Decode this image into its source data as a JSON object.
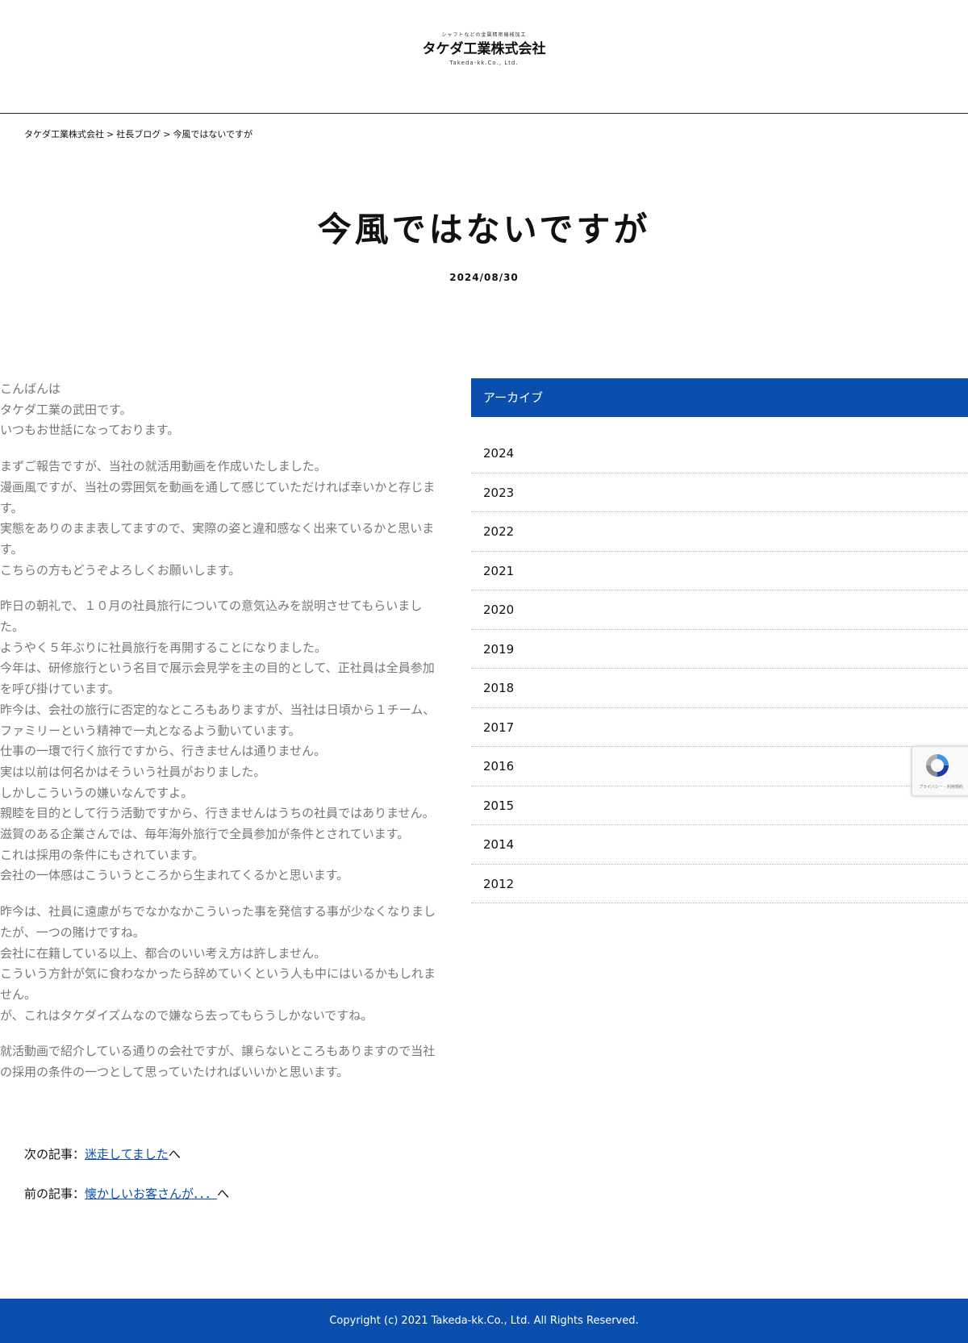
{
  "header": {
    "logo_tagline": "シャフトなどの金属精密機械加工",
    "logo_name": "タケダ工業株式会社",
    "logo_en": "Takeda-kk.Co., Ltd."
  },
  "breadcrumb": {
    "items": [
      "タケダ工業株式会社",
      "社長ブログ",
      "今風ではないですが"
    ],
    "separator": ">"
  },
  "article": {
    "title": "今風ではないですが",
    "date": "2024/08/30",
    "paragraphs": [
      [
        "こんばんは",
        "タケダ工業の武田です。",
        "いつもお世話になっております。"
      ],
      [
        "まずご報告ですが、当社の就活用動画を作成いたしました。",
        "漫画風ですが、当社の雰囲気を動画を通して感じていただければ幸いかと存じま",
        "す。",
        "実態をありのまま表してますので、実際の姿と違和感なく出来ているかと思いま",
        "す。",
        "こちらの方もどうぞよろしくお願いします。"
      ],
      [
        "昨日の朝礼で、１０月の社員旅行についての意気込みを説明させてもらいまし",
        "た。",
        "ようやく５年ぶりに社員旅行を再開することになりました。",
        "今年は、研修旅行という名目で展示会見学を主の目的として、正社員は全員参加",
        "を呼び掛けています。",
        "昨今は、会社の旅行に否定的なところもありますが、当社は日頃から１チーム、",
        "ファミリーという精神で一丸となるよう動いています。",
        "仕事の一環で行く旅行ですから、行きませんは通りません。",
        "実は以前は何名かはそういう社員がおりました。",
        "しかしこういうの嫌いなんですよ。",
        "親睦を目的として行う活動ですから、行きませんはうちの社員ではありません。",
        "滋賀のある企業さんでは、毎年海外旅行で全員参加が条件とされています。",
        "これは採用の条件にもされています。",
        "会社の一体感はこういうところから生まれてくるかと思います。"
      ],
      [
        "昨今は、社員に遠慮がちでなかなかこういった事を発信する事が少なくなりまし",
        "たが、一つの賭けですね。",
        "会社に在籍している以上、都合のいい考え方は許しません。",
        "こういう方針が気に食わなかったら辞めていくという人も中にはいるかもしれま",
        "せん。",
        "が、これはタケダイズムなので嫌なら去ってもらうしかないですね。"
      ],
      [
        "就活動画で紹介している通りの会社ですが、譲らないところもありますので当社",
        "の採用の条件の一つとして思っていたければいいかと思います。"
      ]
    ]
  },
  "sidebar": {
    "heading": "アーカイブ",
    "years": [
      "2024",
      "2023",
      "2022",
      "2021",
      "2020",
      "2019",
      "2018",
      "2017",
      "2016",
      "2015",
      "2014",
      "2012"
    ]
  },
  "post_nav": {
    "next_prefix": "次の記事：",
    "next_title": "迷走してました",
    "next_suffix": "へ",
    "prev_prefix": "前の記事：",
    "prev_title": "懐かしいお客さんが．．．",
    "prev_suffix": "へ"
  },
  "recaptcha": {
    "text": "プライバシー - 利用規約"
  },
  "footer": {
    "copyright": "Copyright (c) 2021 Takeda-kk.Co., Ltd. All Rights Reserved."
  },
  "colors": {
    "accent": "#0a4fad",
    "body_text": "#777777"
  }
}
